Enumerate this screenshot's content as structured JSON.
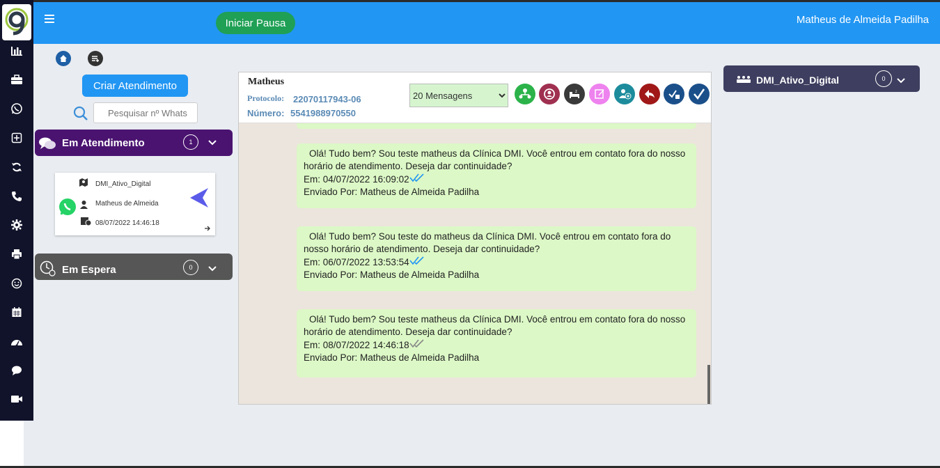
{
  "header": {
    "pause_button": "Iniciar Pausa",
    "user_name": "Matheus de Almeida Padilha"
  },
  "left": {
    "create_button": "Criar Atendimento",
    "search_placeholder": "Pesquisar nº Whats",
    "in_service": {
      "label": "Em Atendimento",
      "count": "1"
    },
    "waiting": {
      "label": "Em Espera",
      "count": "0"
    },
    "card": {
      "queue": "DMI_Ativo_Digital",
      "agent": "Matheus de Almeida",
      "datetime": "08/07/2022 14:46:18"
    }
  },
  "chat": {
    "contact_name": "Matheus",
    "protocol_label": "Protocolo:",
    "protocol": "22070117943-06",
    "number_label": "Número:",
    "number": "5541988970550",
    "messages_select": "20 Mensagens",
    "messages": [
      {
        "text": "Olá! Tudo bem? Sou teste matheus da Clínica DMI. Você entrou em contato fora do nosso horário de atendimento. Deseja dar continuidade?",
        "date": "Em: 04/07/2022 16:09:02",
        "sender": "Enviado Por: Matheus de Almeida Padilha",
        "read": true
      },
      {
        "text": "Olá! Tudo bem? Sou teste do matheus da Clínica DMI. Você entrou em contato fora do nosso horário de atendimento. Deseja dar continuidade?",
        "date": "Em: 06/07/2022 13:53:54",
        "sender": "Enviado Por: Matheus de Almeida Padilha",
        "read": true
      },
      {
        "text": "Olá! Tudo bem? Sou teste matheus da Clínica DMI. Você entrou em contato fora do nosso horário de atendimento. Deseja dar continuidade?",
        "date": "Em: 08/07/2022 14:46:18",
        "sender": "Enviado Por: Matheus de Almeida Padilha",
        "read": false
      }
    ]
  },
  "queue_panel": {
    "label": "DMI_Ativo_Digital",
    "count": "0"
  },
  "colors": {
    "header": "#2196f3",
    "sidebar": "#11132a",
    "pause": "#1fa055",
    "in_service": "#4a1370",
    "waiting": "#565656",
    "bubble": "#dcf8c6",
    "read_tick": "#2196f3",
    "unread_tick": "#888888"
  },
  "icons": {
    "sidebar": [
      "chart-icon",
      "briefcase-icon",
      "whatsapp-icon",
      "plus-square-icon",
      "refresh-icon",
      "phone-icon",
      "gear-icon",
      "printer-icon",
      "smile-icon",
      "calendar-icon",
      "dashboard-icon",
      "chat-icon",
      "video-icon"
    ]
  }
}
